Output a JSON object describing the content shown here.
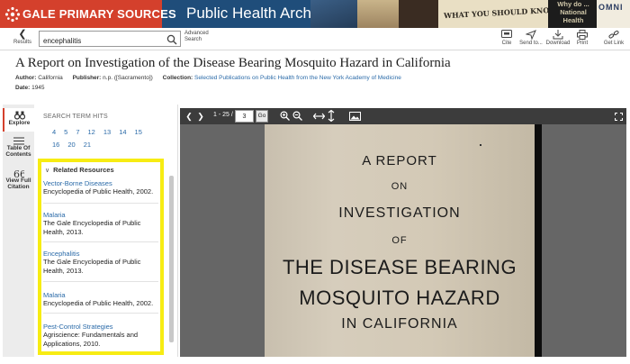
{
  "header": {
    "brand": "GALE PRIMARY SOURCES",
    "archive_title": "Public Health Archives",
    "poster_text": "WHAT YOU SHOULD KNOW",
    "poster_text2": "Why do ... National Health",
    "poster_text3": "OMNI"
  },
  "toolbar": {
    "results_label": "Results",
    "search_value": "encephalitis",
    "advanced_search": "Advanced Search",
    "cite": "Cite",
    "send_to": "Send to...",
    "download": "Download",
    "print": "Print",
    "get_link": "Get Link"
  },
  "document": {
    "title": "A Report on Investigation of the Disease Bearing Mosquito Hazard in California",
    "author_label": "Author:",
    "author": "California",
    "publisher_label": "Publisher:",
    "publisher": "n.p. ([Sacramento])",
    "collection_label": "Collection:",
    "collection": "Selected Publications on Public Health from the New York Academy of Medicine",
    "date_label": "Date:",
    "date": "1945"
  },
  "rail": {
    "explore": "Explore",
    "toc": "Table Of Contents",
    "citation": "View Full Citation"
  },
  "explore": {
    "hits_title": "SEARCH TERM HITS",
    "hits_row1": [
      "4",
      "5",
      "7",
      "12",
      "13",
      "14",
      "15"
    ],
    "hits_row2": [
      "16",
      "20",
      "21"
    ]
  },
  "related": {
    "heading": "Related Resources",
    "items": [
      {
        "title": "Vector-Borne Diseases",
        "source": "Encyclopedia of Public Health, 2002."
      },
      {
        "title": "Malaria",
        "source": "The Gale Encyclopedia of Public Health, 2013."
      },
      {
        "title": "Encephalitis",
        "source": "The Gale Encyclopedia of Public Health, 2013."
      },
      {
        "title": "Malaria",
        "source": "Encyclopedia of Public Health, 2002."
      },
      {
        "title": "Pest-Control Strategies",
        "source": "Agriscience: Fundamentals and Applications, 2010."
      }
    ]
  },
  "viewer": {
    "page_range": "1 - 25 /",
    "page_value": "3",
    "go": "Go",
    "scan_lines": [
      "A REPORT",
      "ON",
      "INVESTIGATION",
      "OF",
      "THE DISEASE BEARING",
      "MOSQUITO HAZARD",
      "IN CALIFORNIA"
    ]
  },
  "colors": {
    "brand_red": "#d4402c",
    "banner_blue": "#1f4d7a",
    "link_blue": "#2a6aa8",
    "highlight_yellow": "#f7ec13",
    "viewer_bar": "#3c3c3c"
  }
}
